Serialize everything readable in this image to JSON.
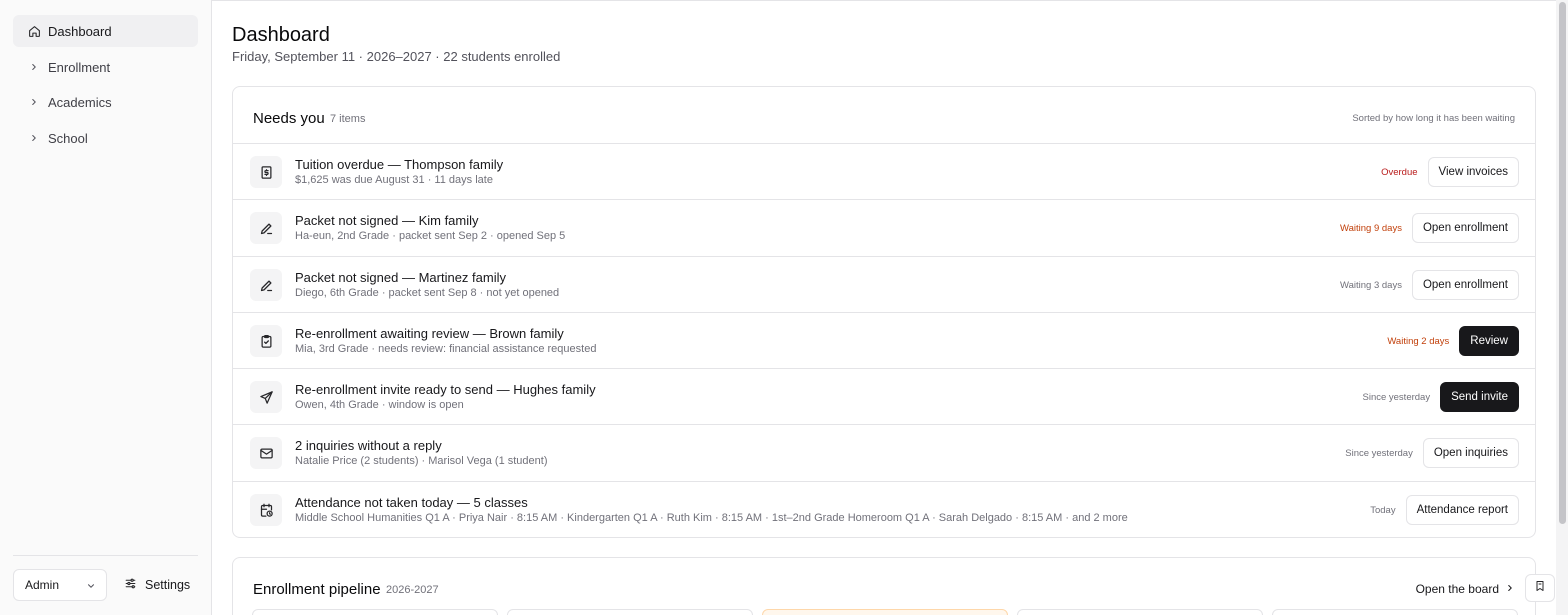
{
  "sidebar": {
    "items": [
      {
        "label": "Dashboard",
        "icon": "home-icon",
        "active": true
      },
      {
        "label": "Enrollment",
        "icon": "chevron-right-icon"
      },
      {
        "label": "Academics",
        "icon": "chevron-right-icon"
      },
      {
        "label": "School",
        "icon": "chevron-right-icon"
      }
    ],
    "role": "Admin",
    "settings_label": "Settings"
  },
  "header": {
    "title": "Dashboard",
    "subtitle": "Friday, September 11 · 2026–2027 · 22 students enrolled"
  },
  "needs_you": {
    "title": "Needs you",
    "count": "7 items",
    "sort_note": "Sorted by how long it has been waiting",
    "items": [
      {
        "icon": "dollar-receipt-icon",
        "title": "Tuition overdue — Thompson family",
        "subtitle": "$1,625 was due August 31 · 11 days late",
        "status": "Overdue",
        "status_color": "#b91c1c",
        "action": "View invoices",
        "primary": false
      },
      {
        "icon": "pen-icon",
        "title": "Packet not signed — Kim family",
        "subtitle": "Ha-eun, 2nd Grade · packet sent Sep 2 · opened Sep 5",
        "status": "Waiting 9 days",
        "status_color": "#c2410c",
        "action": "Open enrollment",
        "primary": false
      },
      {
        "icon": "pen-icon",
        "title": "Packet not signed — Martinez family",
        "subtitle": "Diego, 6th Grade · packet sent Sep 8 · not yet opened",
        "status": "Waiting 3 days",
        "status_color": "#71717a",
        "action": "Open enrollment",
        "primary": false
      },
      {
        "icon": "clipboard-check-icon",
        "title": "Re-enrollment awaiting review — Brown family",
        "subtitle": "Mia, 3rd Grade · needs review: financial assistance requested",
        "status": "Waiting 2 days",
        "status_color": "#c2410c",
        "action": "Review",
        "primary": true
      },
      {
        "icon": "send-icon",
        "title": "Re-enrollment invite ready to send — Hughes family",
        "subtitle": "Owen, 4th Grade · window is open",
        "status": "Since yesterday",
        "status_color": "#71717a",
        "action": "Send invite",
        "primary": true
      },
      {
        "icon": "mail-icon",
        "title": "2 inquiries without a reply",
        "subtitle": "Natalie Price (2 students) · Marisol Vega (1 student)",
        "status": "Since yesterday",
        "status_color": "#71717a",
        "action": "Open inquiries",
        "primary": false
      },
      {
        "icon": "calendar-clock-icon",
        "title": "Attendance not taken today — 5 classes",
        "subtitle": "Middle School Humanities Q1 A · Priya Nair · 8:15 AM · Kindergarten Q1 A · Ruth Kim · 8:15 AM · 1st–2nd Grade Homeroom Q1 A · Sarah Delgado · 8:15 AM · and 2 more",
        "status": "Today",
        "status_color": "#71717a",
        "action": "Attendance report",
        "primary": false
      }
    ]
  },
  "pipeline": {
    "title": "Enrollment pipeline",
    "year": "2026-2027",
    "link_label": "Open the board"
  }
}
